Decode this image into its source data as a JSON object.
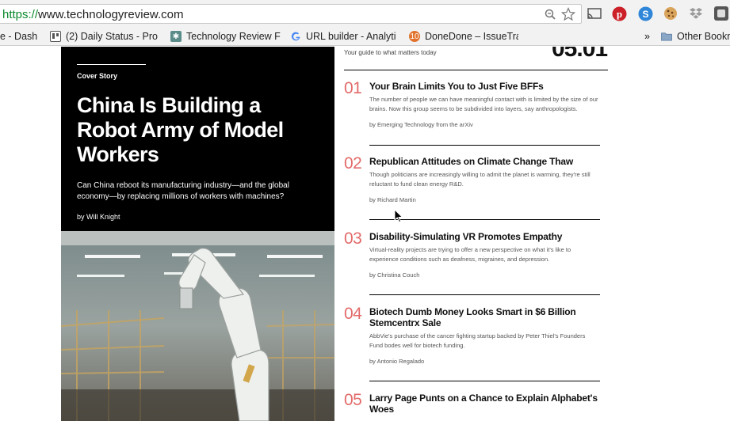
{
  "browser": {
    "url_scheme": "https://",
    "url_rest": "www.technologyreview.com",
    "bookmarks": [
      {
        "label": "e - Dash",
        "icon": "none"
      },
      {
        "label": "(2) Daily Status - Pro",
        "icon": "trello-icon"
      },
      {
        "label": "Technology Review F",
        "icon": "tr-icon"
      },
      {
        "label": "URL builder - Analyti",
        "icon": "google-icon"
      },
      {
        "label": "DoneDone – IssueTra",
        "icon": "donedone-icon"
      }
    ],
    "overflow_label": "»",
    "other_bookmarks_label": "Other Bookm"
  },
  "header": {
    "tagline": "Your guide to what matters today",
    "issue_date": "05.01"
  },
  "cover": {
    "kicker": "Cover Story",
    "headline": "China Is Building a Robot Army of Model Workers",
    "dek": "Can China reboot its manufacturing industry—and the global economy—by replacing millions of workers with machines?",
    "byline": "by Will Knight"
  },
  "stories": [
    {
      "number": "01",
      "title": "Your Brain Limits You to Just Five BFFs",
      "summary": "The number of people we can have meaningful contact with is limited by the size of our brains. Now this group seems to be subdivided into layers, say anthropologists.",
      "byline": "by Emerging Technology from the arXiv"
    },
    {
      "number": "02",
      "title": "Republican Attitudes on Climate Change Thaw",
      "summary": "Though politicians are increasingly willing to admit the planet is warming, they're still reluctant to fund clean energy R&D.",
      "byline": "by Richard Martin"
    },
    {
      "number": "03",
      "title": "Disability-Simulating VR Promotes Empathy",
      "summary": "Virtual-reality projects are trying to offer a new perspective on what it's like to experience conditions such as deafness, migraines, and depression.",
      "byline": "by Christina Couch"
    },
    {
      "number": "04",
      "title": "Biotech Dumb Money Looks Smart in $6 Billion Stemcentrx Sale",
      "summary": "AbbVie's purchase of the cancer fighting startup backed by Peter Thiel's Founders Fund bodes well for biotech funding.",
      "byline": "by Antonio Regalado"
    },
    {
      "number": "05",
      "title": "Larry Page Punts on a Chance to Explain Alphabet's Woes",
      "summary": "",
      "byline": ""
    }
  ],
  "colors": {
    "accent_number": "#e36a6a",
    "cover_bg": "#000000",
    "url_scheme": "#0b8a2e"
  }
}
